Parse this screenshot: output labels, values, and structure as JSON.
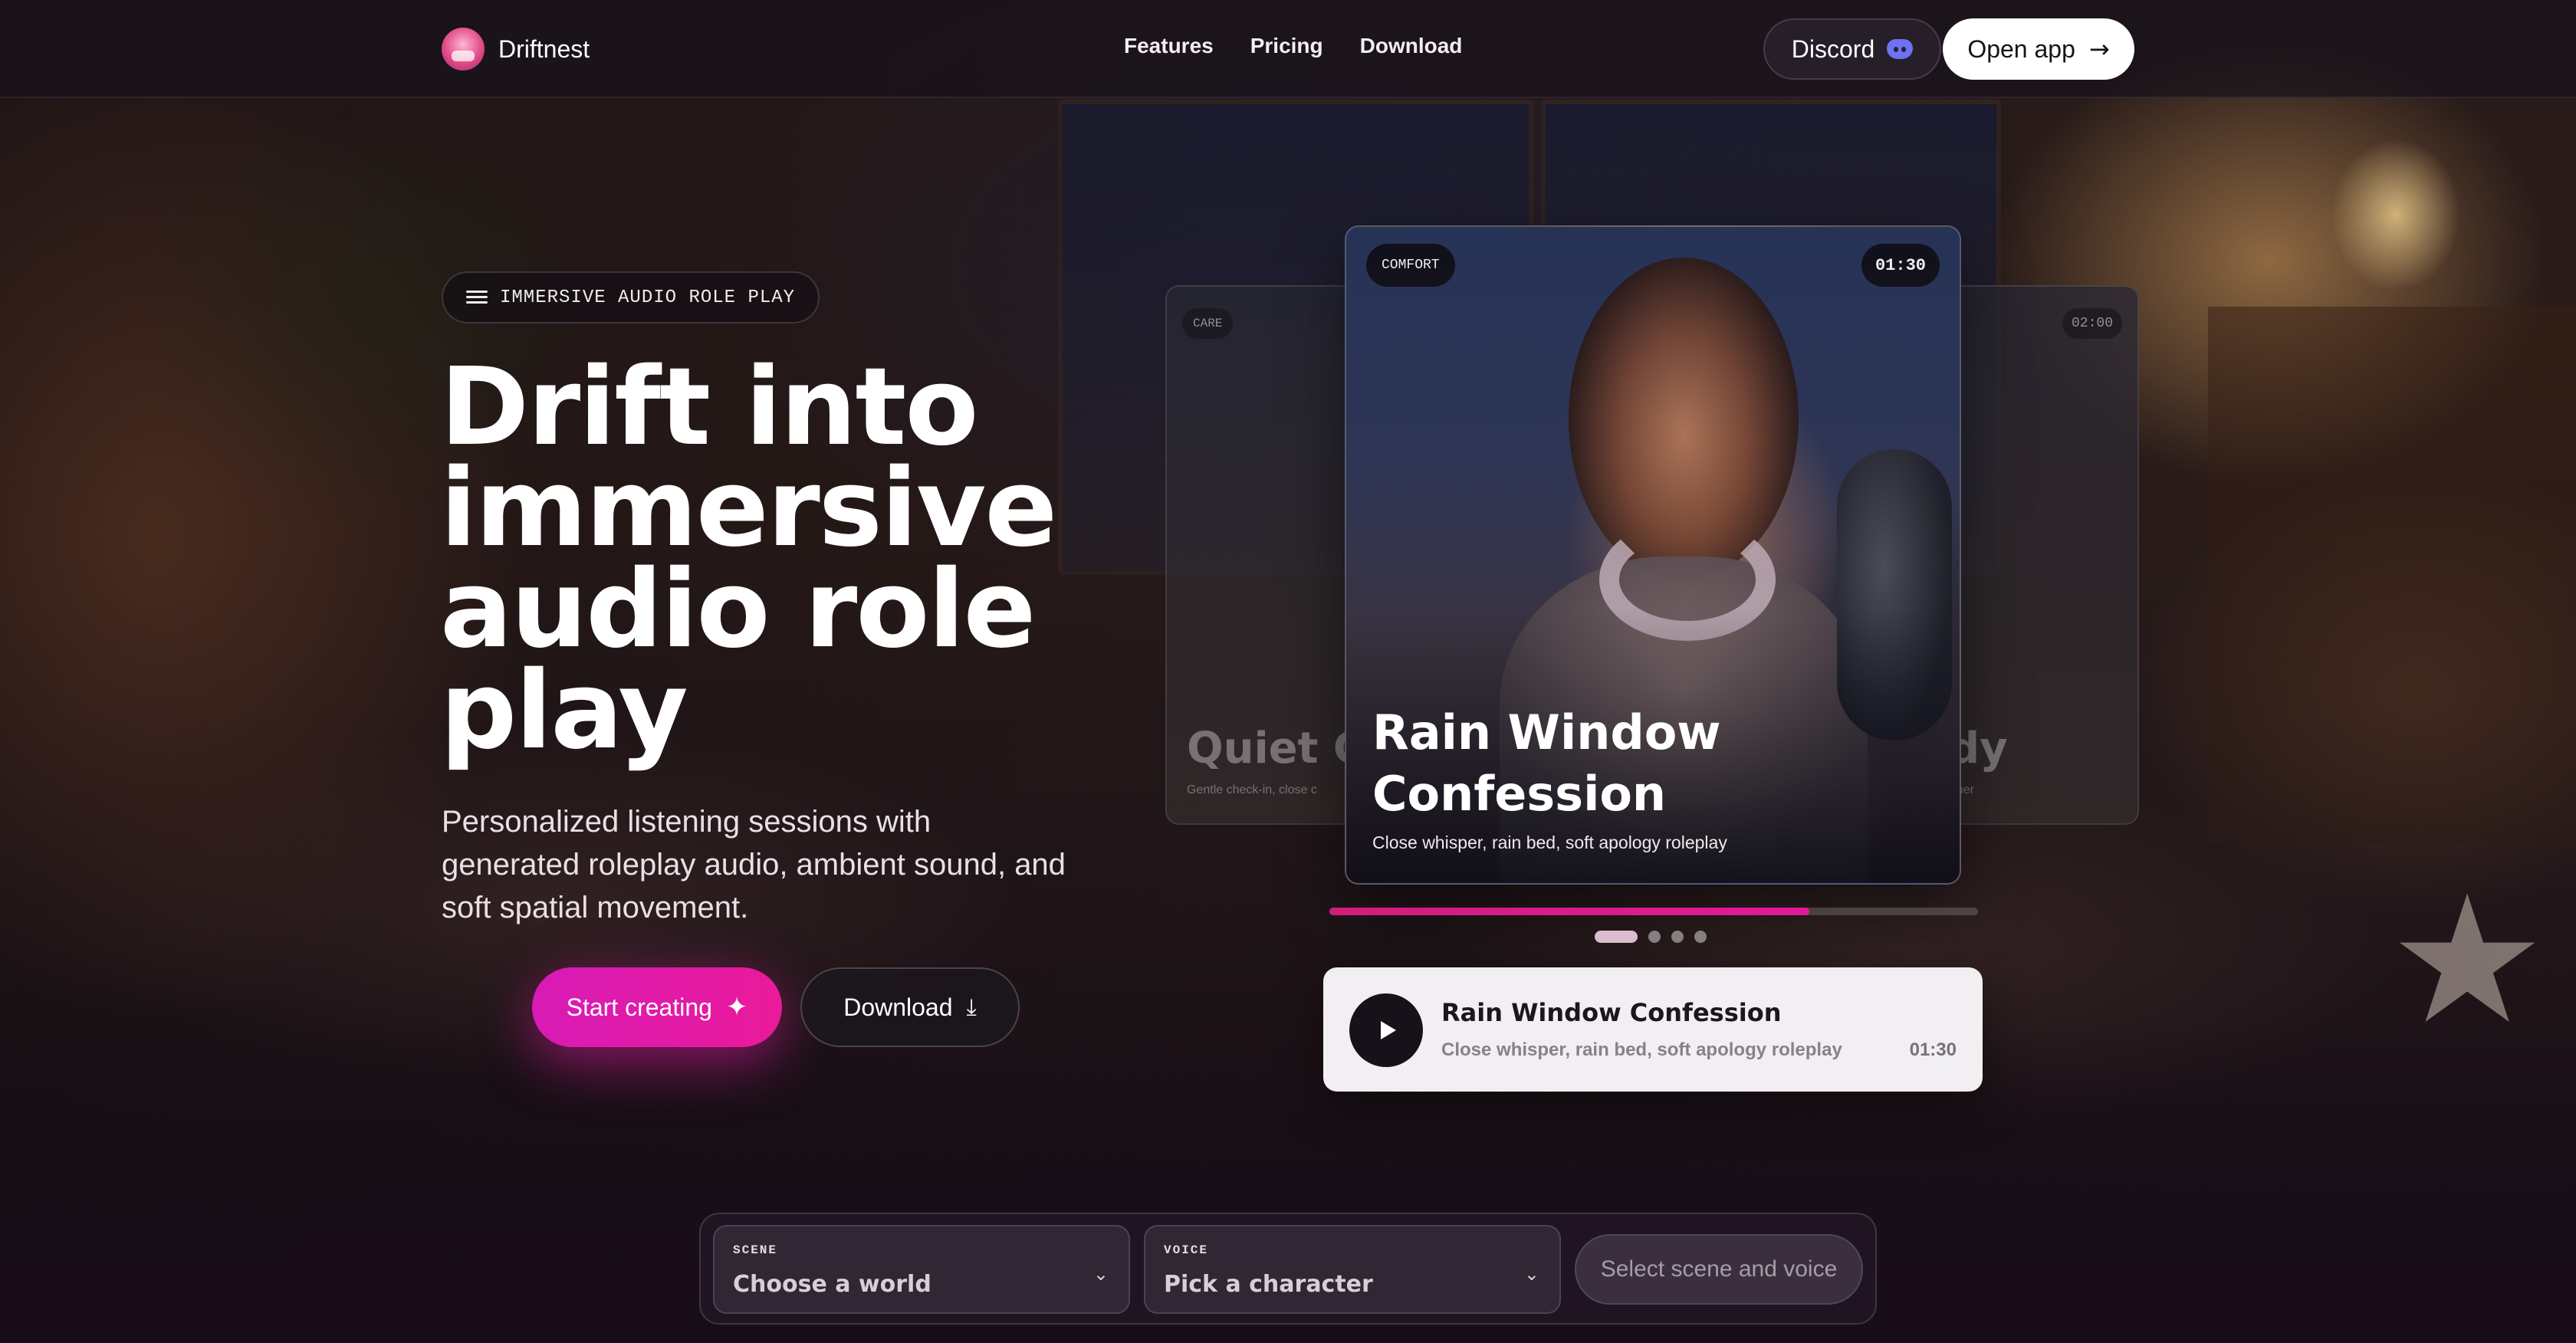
{
  "header": {
    "brand": "Driftnest",
    "nav": [
      "Features",
      "Pricing",
      "Download"
    ],
    "discord_label": "Discord",
    "open_app_label": "Open app"
  },
  "hero": {
    "eyebrow": "IMMERSIVE AUDIO ROLE PLAY",
    "headline": "Drift into immersive audio role play",
    "subtext": "Personalized listening sessions with generated roleplay audio, ambient sound, and soft spatial movement.",
    "primary_cta": "Start creating",
    "secondary_cta": "Download"
  },
  "carousel": {
    "left_card": {
      "tag": "CARE",
      "title": "Quiet Cl",
      "subtitle": "Gentle check-in, close c"
    },
    "main_card": {
      "tag": "COMFORT",
      "duration": "01:30",
      "title": "Rain Window Confession",
      "subtitle": "Close whisper, rain bed, soft apology roleplay"
    },
    "right_card": {
      "duration": "02:00",
      "title": "dy",
      "subtitle": "rtner"
    },
    "progress_fraction": 0.74,
    "dots_total": 4,
    "active_dot": 0
  },
  "player": {
    "title": "Rain Window Confession",
    "subtitle": "Close whisper, rain bed, soft apology roleplay",
    "time": "01:30"
  },
  "selector": {
    "scene_label": "SCENE",
    "scene_value": "Choose a world",
    "voice_label": "VOICE",
    "voice_value": "Pick a character",
    "submit_label": "Select scene and voice"
  },
  "colors": {
    "accent": "#e21a9a",
    "discord": "#6d72f2"
  },
  "icons": [
    "logo-icon",
    "discord-icon",
    "arrow-right-icon",
    "waves-icon",
    "sparkle-icon",
    "download-icon",
    "play-icon",
    "chevron-down-icon"
  ]
}
